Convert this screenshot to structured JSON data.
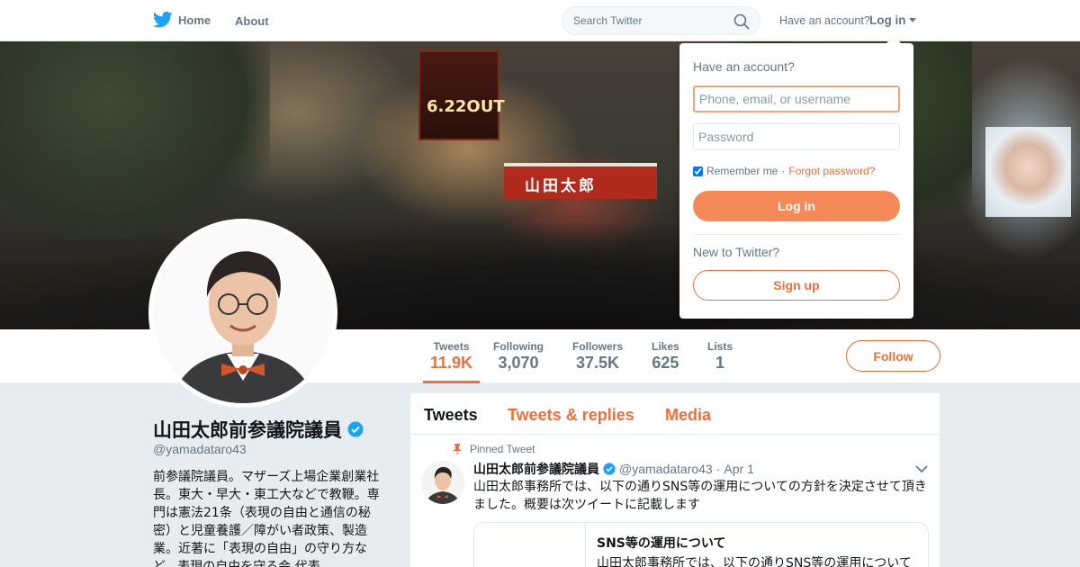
{
  "nav": {
    "home_label": "Home",
    "about_label": "About",
    "search_placeholder": "Search Twitter",
    "have_account": "Have an account?",
    "login_label": "Log in",
    "brand_color": "#1da1f2"
  },
  "banner": {
    "sign_text": "6.22OUT",
    "truck_text": "山田太郎"
  },
  "profile": {
    "name": "山田太郎前参議院議員",
    "handle": "@yamadataro43",
    "bio": "前参議院議員。マザーズ上場企業創業社長。東大・早大・東工大などで教鞭。専門は憲法21条（表現の自由と通信の秘密）と児童養護／障がい者政策、製造業。近著に「表現の自由」の守り方など。表現の自由を守る会 代表",
    "verified": true
  },
  "stats": [
    {
      "label": "Tweets",
      "value": "11.9K",
      "active": true
    },
    {
      "label": "Following",
      "value": "3,070",
      "active": false
    },
    {
      "label": "Followers",
      "value": "37.5K",
      "active": false
    },
    {
      "label": "Likes",
      "value": "625",
      "active": false
    },
    {
      "label": "Lists",
      "value": "1",
      "active": false
    }
  ],
  "follow_label": "Follow",
  "accent_color": "#f06e3c",
  "timeline": {
    "tabs": [
      "Tweets",
      "Tweets & replies",
      "Media"
    ],
    "pinned_label": "Pinned Tweet",
    "tweet": {
      "name": "山田太郎前参議院議員",
      "handle": "@yamadataro43",
      "separator": "·",
      "date": "Apr 1",
      "text": "山田太郎事務所では、以下の通りSNS等の運用についての方針を決定させて頂きました。概要は次ツイートに記載します",
      "card_title": "SNS等の運用について",
      "card_desc": "山田太郎事務所では、以下の通りSNS等の運用について"
    }
  },
  "login": {
    "title": "Have an account?",
    "username_placeholder": "Phone, email, or username",
    "password_placeholder": "Password",
    "remember_label": "Remember me",
    "separator": "·",
    "forgot_label": "Forgot password?",
    "login_button": "Log in",
    "new_label": "New to Twitter?",
    "signup_button": "Sign up"
  }
}
